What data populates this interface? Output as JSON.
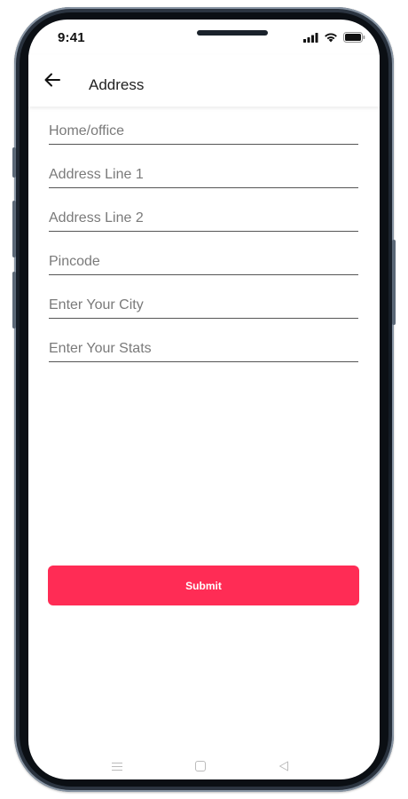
{
  "status_bar": {
    "time": "9:41",
    "icons": [
      "signal-icon",
      "wifi-icon",
      "battery-icon"
    ]
  },
  "app_bar": {
    "title": "Address",
    "back_icon": "arrow-left-icon"
  },
  "form": {
    "fields": [
      {
        "name": "home-office-field",
        "placeholder": "Home/office",
        "value": ""
      },
      {
        "name": "address-line-1-field",
        "placeholder": "Address Line 1",
        "value": ""
      },
      {
        "name": "address-line-2-field",
        "placeholder": "Address Line 2",
        "value": ""
      },
      {
        "name": "pincode-field",
        "placeholder": "Pincode",
        "value": ""
      },
      {
        "name": "city-field",
        "placeholder": "Enter Your City",
        "value": ""
      },
      {
        "name": "state-field",
        "placeholder": "Enter Your Stats",
        "value": ""
      }
    ],
    "submit_label": "Submit"
  },
  "colors": {
    "accent": "#ff2c55",
    "divider": "#555555",
    "text": "#222222"
  },
  "nav_bar": {
    "buttons": [
      "menu-icon",
      "home-square-icon",
      "back-triangle-icon"
    ]
  }
}
